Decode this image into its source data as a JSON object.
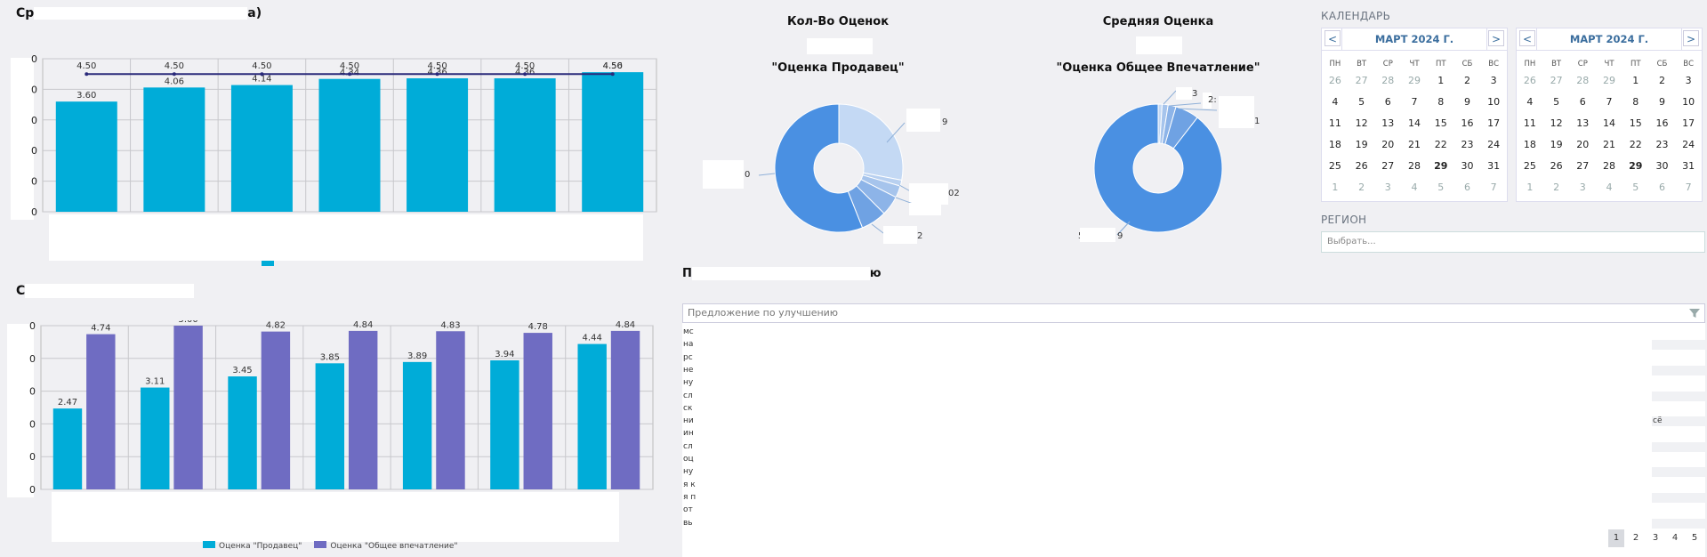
{
  "top_left": {
    "title_start": "Ср",
    "title_end": "а)",
    "chart_data": {
      "type": "bar",
      "series": [
        {
          "kind": "bar",
          "values": [
            3.6,
            4.06,
            4.14,
            4.34,
            4.36,
            4.36,
            4.56
          ]
        },
        {
          "kind": "line",
          "values": [
            4.5,
            4.5,
            4.5,
            4.5,
            4.5,
            4.5,
            4.5
          ]
        }
      ],
      "bar_labels": [
        "3.60",
        "4.06",
        "4.14",
        "4.34",
        "4.36",
        "4.36",
        "4.56"
      ],
      "line_labels": [
        "4.50",
        "4.50",
        "4.50",
        "4.50",
        "4.50",
        "4.50",
        "4.50"
      ],
      "y_ticks": [
        "0",
        "0",
        "0",
        "0",
        "0",
        "0"
      ],
      "ylim": [
        0,
        5
      ],
      "grid": true
    }
  },
  "bottom_left": {
    "title_start": "С",
    "legend": [
      "Оценка \"Продавец\"",
      "Оценка \"Общее впечатление\""
    ],
    "chart_data": {
      "type": "bar",
      "series": [
        {
          "values": [
            2.47,
            3.11,
            3.45,
            3.85,
            3.89,
            3.94,
            4.44
          ],
          "color": "#00acd8"
        },
        {
          "values": [
            4.74,
            5.0,
            4.82,
            4.84,
            4.83,
            4.78,
            4.84
          ],
          "color": "#6f6cc2"
        }
      ],
      "labels_a": [
        "2.47",
        "3.11",
        "3.45",
        "3.85",
        "3.89",
        "3.94",
        "4.44"
      ],
      "labels_b": [
        "4.74",
        "5.00",
        "4.82",
        "4.84",
        "4.83",
        "4.78",
        "4.84"
      ],
      "y_ticks": [
        "0",
        "0",
        "0",
        "0",
        "0",
        "0"
      ],
      "ylim": [
        0,
        5
      ],
      "grid": true
    }
  },
  "kpis": {
    "count_title": "Кол-Во Оценок",
    "avg_title": "Средняя Оценка"
  },
  "donut_seller": {
    "title": "\"Оценка Продавец\"",
    "chart_data": {
      "type": "pie",
      "values": [
        0.28,
        0.015,
        0.03,
        0.05,
        0.065,
        0.56
      ],
      "colors": [
        "#c4d9f4",
        "#b8d0f0",
        "#a6c4ec",
        "#8db4e8",
        "#6fa2e3",
        "#4a90e2"
      ],
      "labels": [
        "9",
        "02",
        "",
        "2",
        "0"
      ]
    }
  },
  "donut_overall": {
    "title": "\"Оценка Общее Впечатление\"",
    "chart_data": {
      "type": "pie",
      "values": [
        0.01,
        0.015,
        0.02,
        0.06,
        0.895
      ],
      "colors": [
        "#c4d9f4",
        "#a6c4ec",
        "#8db4e8",
        "#6fa2e3",
        "#4a90e2"
      ],
      "labels": [
        "3",
        "2: 4",
        "1",
        "5",
        "9"
      ]
    }
  },
  "calendar_label": "КАЛЕНДАРЬ",
  "calendars": [
    {
      "month": "МАРТ 2024 Г.",
      "prev": "<",
      "next": ">"
    },
    {
      "month": "МАРТ 2024 Г.",
      "prev": "<",
      "next": ">"
    }
  ],
  "weekdays": [
    "ПН",
    "ВТ",
    "СР",
    "ЧТ",
    "ПТ",
    "СБ",
    "ВС"
  ],
  "calendar_weeks": [
    [
      "26",
      "27",
      "28",
      "29",
      "1",
      "2",
      "3"
    ],
    [
      "4",
      "5",
      "6",
      "7",
      "8",
      "9",
      "10"
    ],
    [
      "11",
      "12",
      "13",
      "14",
      "15",
      "16",
      "17"
    ],
    [
      "18",
      "19",
      "20",
      "21",
      "22",
      "23",
      "24"
    ],
    [
      "25",
      "26",
      "27",
      "28",
      "29",
      "30",
      "31"
    ],
    [
      "1",
      "2",
      "3",
      "4",
      "5",
      "6",
      "7"
    ]
  ],
  "region": {
    "label": "РЕГИОН",
    "placeholder": "Выбрать..."
  },
  "suggestions": {
    "title_start": "П",
    "title_end": "ю",
    "filter_placeholder": "Предложение по улучшению",
    "row_starts": [
      "мс",
      "на",
      "рс",
      "не",
      "ну",
      "сл",
      "ск",
      "ни",
      "ин",
      "сл",
      "оц",
      "ну",
      "я к",
      "я п",
      "от",
      "вь"
    ],
    "row_end_text": "сё",
    "pages": [
      "1",
      "2",
      "3",
      "4",
      "5"
    ]
  }
}
